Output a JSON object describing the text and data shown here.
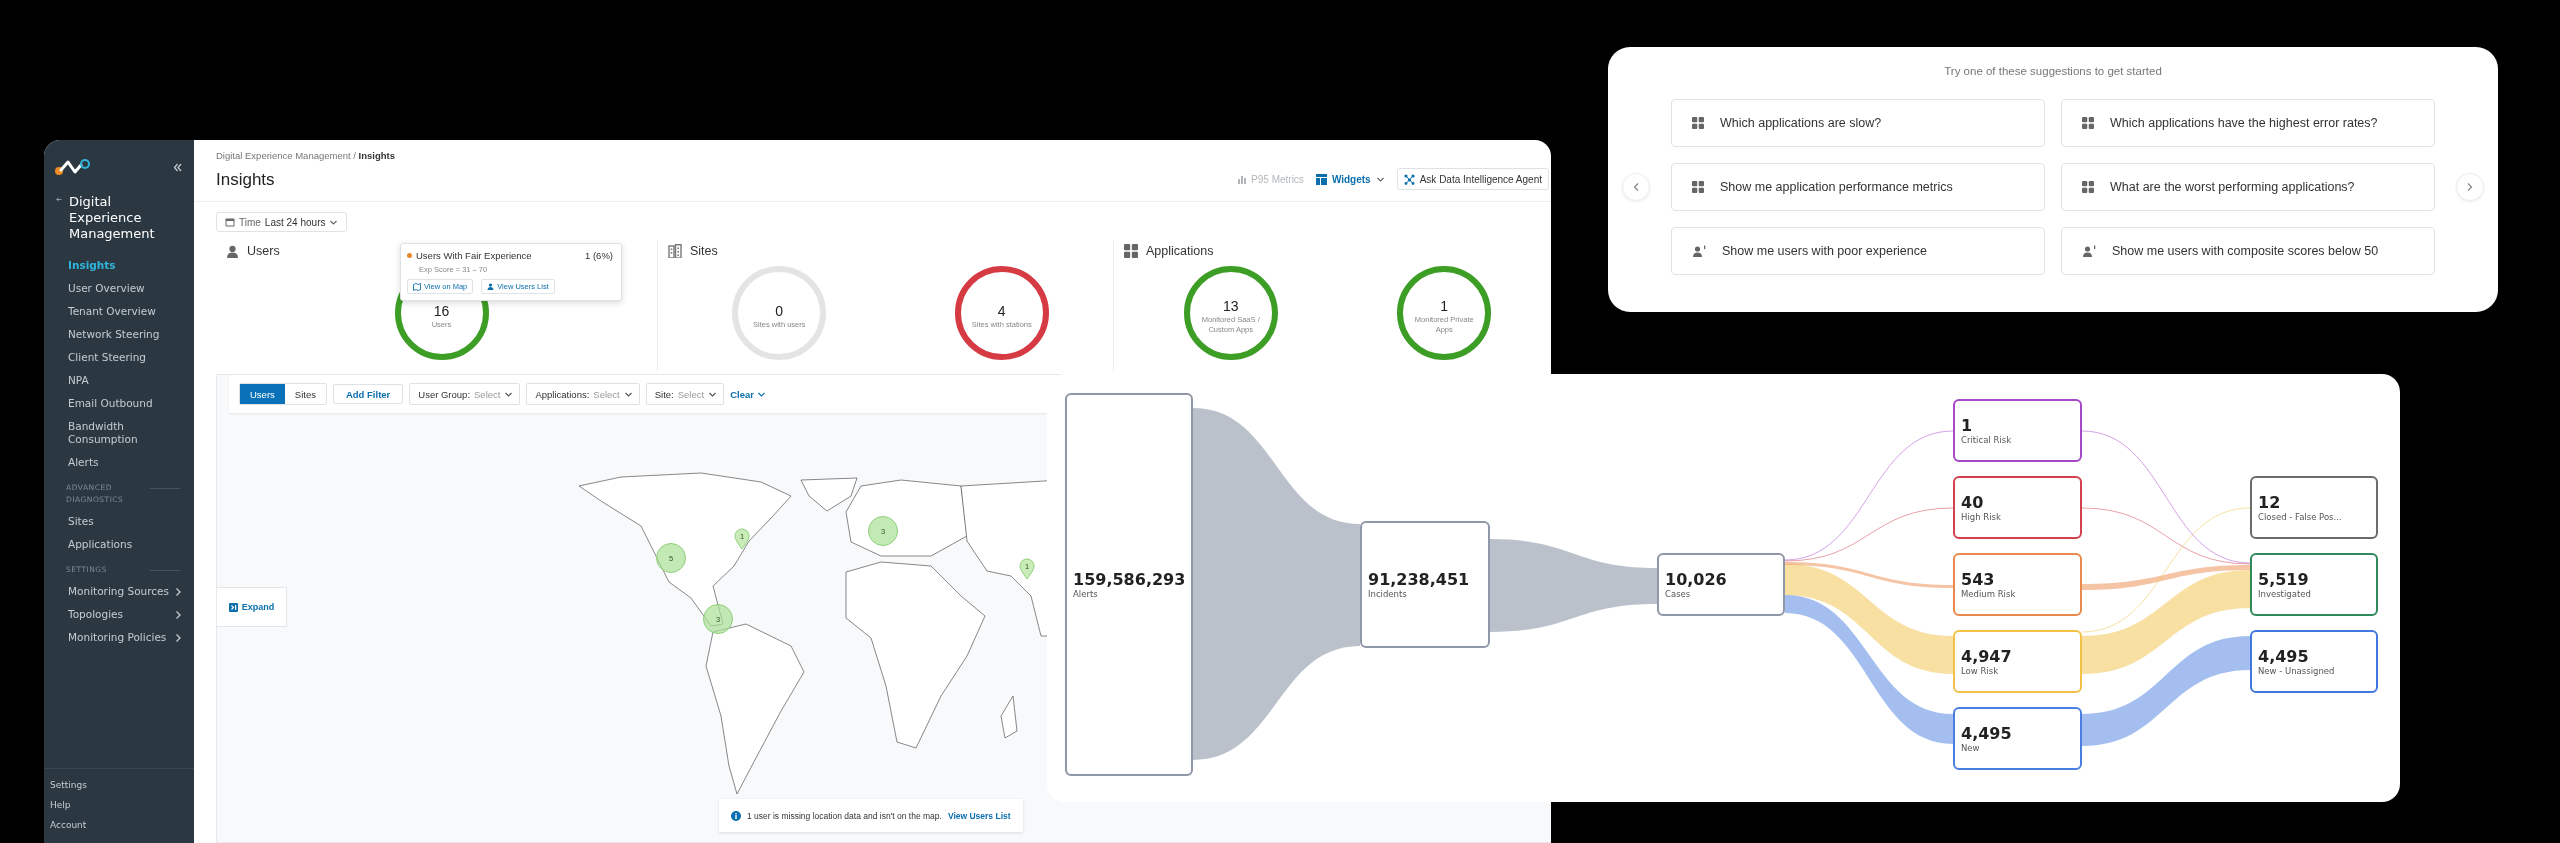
{
  "dashboard": {
    "sidebar": {
      "title": "Digital Experience Management",
      "groups": [
        {
          "items": [
            {
              "label": "Insights",
              "selected": true,
              "expandable": false
            },
            {
              "label": "User Overview",
              "selected": false,
              "expandable": false
            },
            {
              "label": "Tenant Overview",
              "selected": false,
              "expandable": false
            },
            {
              "label": "Network Steering",
              "selected": false,
              "expandable": false
            },
            {
              "label": "Client Steering",
              "selected": false,
              "expandable": false
            },
            {
              "label": "NPA",
              "selected": false,
              "expandable": false
            },
            {
              "label": "Email Outbound",
              "selected": false,
              "expandable": false
            },
            {
              "label": "Bandwidth Consumption",
              "selected": false,
              "expandable": false
            },
            {
              "label": "Alerts",
              "selected": false,
              "expandable": false
            }
          ]
        },
        {
          "heading": "ADVANCED DIAGNOSTICS",
          "items": [
            {
              "label": "Sites",
              "selected": false,
              "expandable": false
            },
            {
              "label": "Applications",
              "selected": false,
              "expandable": false
            }
          ]
        },
        {
          "heading": "SETTINGS",
          "items": [
            {
              "label": "Monitoring Sources",
              "selected": false,
              "expandable": true
            },
            {
              "label": "Topologies",
              "selected": false,
              "expandable": true
            },
            {
              "label": "Monitoring Policies",
              "selected": false,
              "expandable": true
            }
          ]
        }
      ],
      "footer": [
        "Settings",
        "Help",
        "Account"
      ]
    },
    "breadcrumb": "Digital Experience Management / **Insights**",
    "title": "Insights",
    "toolbar": {
      "metrics": "P95 Metrics",
      "widgets": "Widgets",
      "agent_button": "Ask Data Intelligence Agent"
    },
    "time_filter": {
      "label": "Time",
      "value": "Last 24 hours"
    },
    "summary": [
      {
        "title": "Users",
        "kind": "users",
        "donuts": [
          {
            "value": "16",
            "label": "Users",
            "color": "#3c9e25"
          }
        ]
      },
      {
        "title": "Sites",
        "kind": "sites",
        "donuts": [
          {
            "value": "0",
            "label": "Sites with users",
            "color": "#e4e4e4"
          },
          {
            "value": "4",
            "label": "Sites with stations",
            "color": "#d63a43"
          }
        ]
      },
      {
        "title": "Applications",
        "kind": "applications",
        "donuts": [
          {
            "value": "13",
            "label": "Monitored SaaS / Custom Apps",
            "color": "#3c9e25"
          },
          {
            "value": "1",
            "label": "Monitored Private Apps",
            "color": "#3c9e25"
          }
        ]
      }
    ],
    "tooltip": {
      "title": "Users With Fair Experience",
      "count": "1 (6%)",
      "detail": "Exp Score = 31 – 70",
      "color": "#e8892b",
      "actions": [
        "View on Map",
        "View Users List"
      ]
    },
    "map_filters": {
      "view_tabs": [
        {
          "label": "Users",
          "selected": true
        },
        {
          "label": "Sites",
          "selected": false
        }
      ],
      "add_filter": "Add Filter",
      "dropdowns": [
        {
          "label": "User Group:",
          "value": "Select"
        },
        {
          "label": "Applications:",
          "value": "Select"
        },
        {
          "label": "Site:",
          "value": "Select"
        }
      ],
      "clear": "Clear"
    },
    "map": {
      "expand": "Expand",
      "markers": [
        {
          "count": "3",
          "kind": "cluster"
        },
        {
          "count": "1",
          "kind": "pin"
        },
        {
          "count": "5",
          "kind": "cluster"
        },
        {
          "count": "1",
          "kind": "pin"
        },
        {
          "count": "3",
          "kind": "cluster"
        }
      ],
      "notice": "1 user is missing location data and isn't on the map.",
      "notice_link": "View Users List"
    }
  },
  "suggestions": {
    "title": "Try one of these suggestions to get started",
    "items": [
      {
        "text": "Which applications are slow?",
        "kind": "applications"
      },
      {
        "text": "Which applications have the highest error rates?",
        "kind": "applications"
      },
      {
        "text": "Show me application performance metrics",
        "kind": "applications"
      },
      {
        "text": "What are the worst performing applications?",
        "kind": "applications"
      },
      {
        "text": "Show me users with poor experience",
        "kind": "users"
      },
      {
        "text": "Show me users with composite scores below 50",
        "kind": "users"
      }
    ]
  },
  "sankey": {
    "nodes": [
      {
        "value": "159,586,293",
        "label": "Alerts",
        "color": "#8e98a8"
      },
      {
        "value": "91,238,451",
        "label": "Incidents",
        "color": "#8e98a8"
      },
      {
        "value": "10,026",
        "label": "Cases",
        "color": "#8e98a8"
      },
      {
        "value": "1",
        "label": "Critical Risk",
        "color": "#a748c9"
      },
      {
        "value": "40",
        "label": "High Risk",
        "color": "#d3414f"
      },
      {
        "value": "543",
        "label": "Medium Risk",
        "color": "#e9894a"
      },
      {
        "value": "4,947",
        "label": "Low Risk",
        "color": "#f1c247"
      },
      {
        "value": "4,495",
        "label": "New",
        "color": "#4a7fe0"
      },
      {
        "value": "12",
        "label": "Closed - False Pos...",
        "color": "#6b6b6b"
      },
      {
        "value": "5,519",
        "label": "Investigated",
        "color": "#2f8a5b"
      },
      {
        "value": "4,495",
        "label": "New - Unassigned",
        "color": "#4177de"
      }
    ]
  }
}
